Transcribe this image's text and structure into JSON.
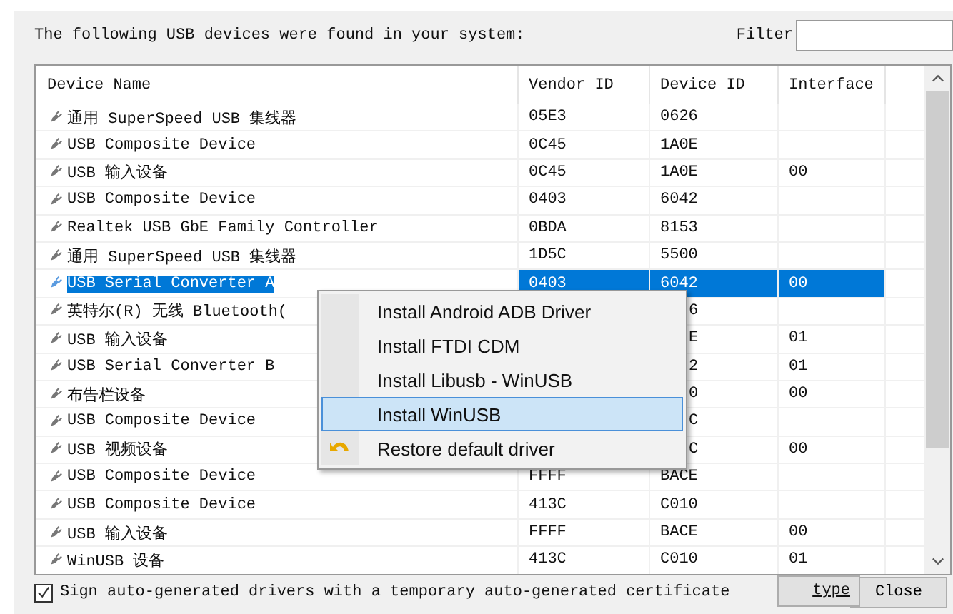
{
  "intro": "The following USB devices were found in your system:",
  "filter": {
    "label": "Filter"
  },
  "table": {
    "columns": [
      "Device Name",
      "Vendor ID",
      "Device ID",
      "Interface"
    ],
    "rows": [
      {
        "name": "通用 SuperSpeed USB 集线器",
        "vendor_id": "05E3",
        "device_id": "0626",
        "selected": false,
        "under_menu": false
      },
      {
        "name": "USB Composite Device",
        "vendor_id": "0C45",
        "device_id": "1A0E",
        "selected": false,
        "under_menu": false
      },
      {
        "name": "USB 输入设备",
        "vendor_id": "0C45",
        "device_id": "1A0E",
        "interface": "00",
        "selected": false,
        "under_menu": false
      },
      {
        "name": "USB Composite Device",
        "vendor_id": "0403",
        "device_id": "6042",
        "selected": false,
        "under_menu": false
      },
      {
        "name": "Realtek USB GbE Family Controller",
        "vendor_id": "0BDA",
        "device_id": "8153",
        "selected": false,
        "under_menu": false
      },
      {
        "name": "通用 SuperSpeed USB 集线器",
        "vendor_id": "1D5C",
        "device_id": "5500",
        "selected": false,
        "under_menu": false
      },
      {
        "name": "USB Serial Converter A",
        "vendor_id": "0403",
        "device_id": "6042",
        "interface": "00",
        "selected": true,
        "under_menu": false
      },
      {
        "name": "英特尔(R) 无线 Bluetooth(",
        "device_id": "6",
        "selected": false,
        "under_menu": true
      },
      {
        "name": "USB 输入设备",
        "device_id": "E",
        "interface": "01",
        "selected": false,
        "under_menu": true
      },
      {
        "name": "USB Serial Converter B",
        "device_id": "2",
        "interface": "01",
        "selected": false,
        "under_menu": true
      },
      {
        "name": "布告栏设备",
        "device_id": "0",
        "interface": "00",
        "selected": false,
        "under_menu": true
      },
      {
        "name": "USB Composite Device",
        "device_id": "C",
        "selected": false,
        "under_menu": true
      },
      {
        "name": "USB 视频设备",
        "device_id": "C",
        "interface": "00",
        "selected": false,
        "under_menu": true
      },
      {
        "name": "USB Composite Device",
        "vendor_id": "FFFF",
        "device_id": "BACE",
        "selected": false,
        "under_menu": false
      },
      {
        "name": "USB Composite Device",
        "vendor_id": "413C",
        "device_id": "C010",
        "selected": false,
        "under_menu": false
      },
      {
        "name": "USB 输入设备",
        "vendor_id": "FFFF",
        "device_id": "BACE",
        "interface": "00",
        "selected": false,
        "under_menu": false
      },
      {
        "name": "WinUSB 设备",
        "vendor_id": "413C",
        "device_id": "C010",
        "interface": "01",
        "selected": false,
        "under_menu": false
      }
    ]
  },
  "context_menu": {
    "items": [
      {
        "label": "Install Android ADB Driver",
        "kind": "plain",
        "selected": false
      },
      {
        "label": "Install FTDI CDM",
        "kind": "plain",
        "selected": false
      },
      {
        "label": "Install Libusb - WinUSB",
        "kind": "plain",
        "selected": false
      },
      {
        "label": "Install WinUSB",
        "kind": "plain",
        "selected": true
      },
      {
        "label": "Restore default driver",
        "kind": "restore",
        "selected": false
      }
    ]
  },
  "sign_checkbox": {
    "label": "Sign auto-generated drivers with a temporary auto-generated certificate",
    "checked": true
  },
  "buttons": [
    "type",
    "Close"
  ]
}
